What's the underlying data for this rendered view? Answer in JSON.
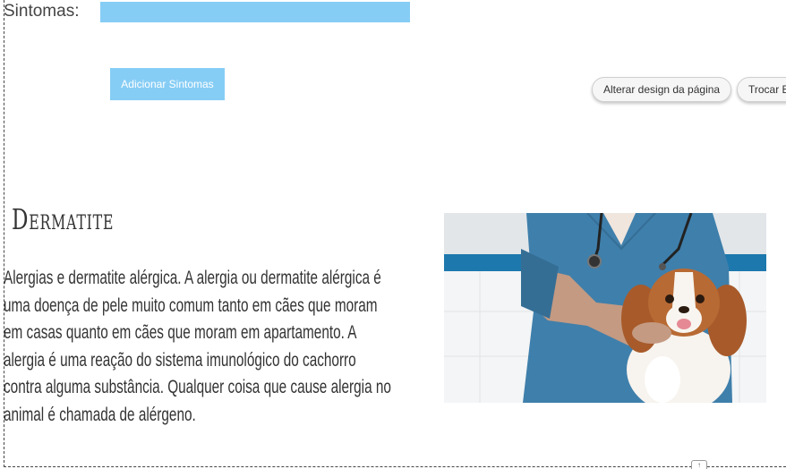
{
  "form": {
    "sintomas_label": "Sintomas:",
    "sintomas_value": "",
    "add_button_label": "Adicionar Sintomas"
  },
  "toolbar": {
    "design_label": "Alterar design da página",
    "trocar_label": "Trocar E"
  },
  "article": {
    "title": "Dermatite",
    "body": "Alergias e dermatite alérgica. A alergia ou dermatite alérgica é uma doença de pele muito comum tanto em cães que moram em casas quanto em cães que moram em apartamento. A alergia é uma reação do sistema imunológico do cachorro contra alguma substância. Qualquer coisa que cause alergia no animal é chamada de alérgeno."
  },
  "colors": {
    "accent": "#86cdf5",
    "text": "#333333",
    "scrub": "#3f7fab"
  },
  "icons": {
    "scroll_top": "scroll-top-icon"
  }
}
